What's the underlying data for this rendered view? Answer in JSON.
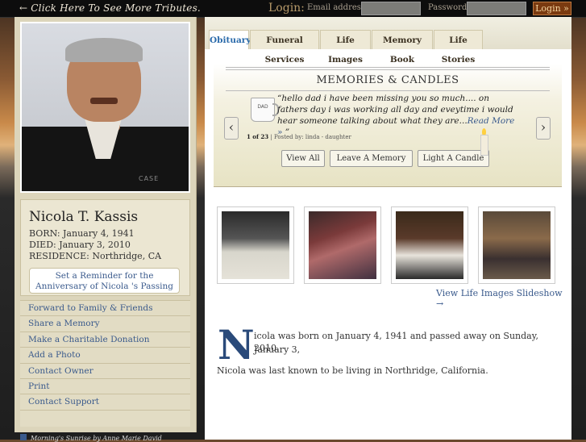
{
  "topbar": {
    "tributes_link": "← Click Here To See More Tributes.",
    "login_label": "Login:",
    "email_label": "Email address:",
    "password_label": "Password:",
    "login_button": "Login »"
  },
  "profile": {
    "photo_logo": "CASE",
    "name": "Nicola T. Kassis",
    "born": "BORN: January 4, 1941",
    "died": "DIED: January 3, 2010",
    "residence": "RESIDENCE: Northridge, CA",
    "reminder": "Set a Reminder for the Anniversary of Nicola 's Passing"
  },
  "sidebar": {
    "items": [
      {
        "label": "Forward to Family & Friends"
      },
      {
        "label": "Share a Memory"
      },
      {
        "label": "Make a Charitable Donation"
      },
      {
        "label": "Add a Photo"
      },
      {
        "label": "Contact Owner"
      },
      {
        "label": "Print"
      },
      {
        "label": "Contact Support"
      }
    ]
  },
  "tabs": [
    {
      "label": "Obituary",
      "active": true
    },
    {
      "label": "Funeral Services"
    },
    {
      "label": "Life Images"
    },
    {
      "label": "Memory Book"
    },
    {
      "label": "Life Stories"
    }
  ],
  "memories": {
    "title": "MEMORIES & CANDLES",
    "mug_text": "DAD",
    "quote": "“hello dad i have been missing you so much.... on fathers day i was working all day and eveytime i would hear someone talking about what they are...",
    "read_more": "Read More »",
    "quote_end": " ”",
    "count": "1 of 23",
    "posted_by": " | Posted by: linda - daughter",
    "view_all": "View All",
    "leave_memory": "Leave A Memory",
    "light_candle": "Light A Candle",
    "prev": "‹",
    "next": "›"
  },
  "slideshow_link": "View Life Images Slideshow →",
  "obituary": {
    "dropcap": "N",
    "line1": "icola was born on January 4, 1941 and passed away on Sunday, January 3,",
    "line1b": "2010.",
    "line2": "Nicola was last known to be living in Northridge, California."
  },
  "footer": "Morning's Sunrise by Anne Marie David"
}
